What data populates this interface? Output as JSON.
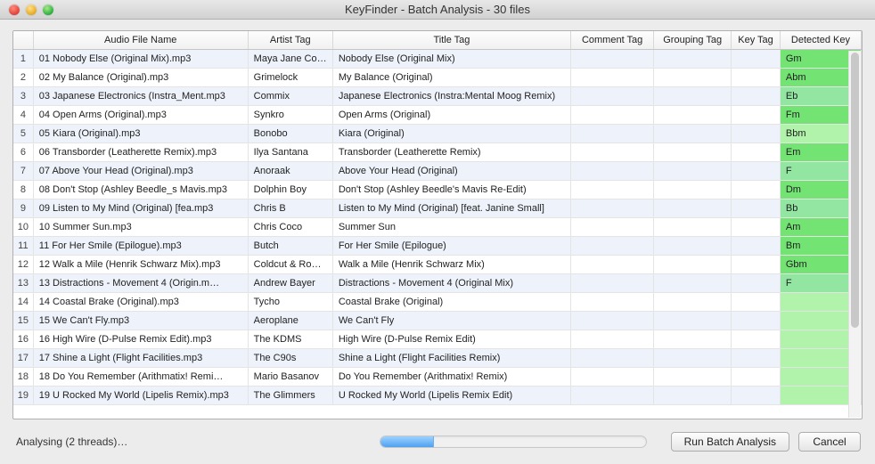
{
  "window": {
    "title": "KeyFinder - Batch Analysis - 30 files"
  },
  "columns": {
    "idx": "",
    "file": "Audio File Name",
    "artist": "Artist Tag",
    "title": "Title Tag",
    "comment": "Comment Tag",
    "grouping": "Grouping Tag",
    "keytag": "Key Tag",
    "detected": "Detected Key"
  },
  "rows": [
    {
      "n": "1",
      "file": "01 Nobody Else (Original Mix).mp3",
      "artist": "Maya Jane Coles",
      "title": "Nobody Else (Original Mix)",
      "comment": "",
      "grouping": "",
      "keytag": "",
      "detected": "Gm",
      "kclass": "k1"
    },
    {
      "n": "2",
      "file": "02 My Balance (Original).mp3",
      "artist": "Grimelock",
      "title": "My Balance (Original)",
      "comment": "",
      "grouping": "",
      "keytag": "",
      "detected": "Abm",
      "kclass": "k1"
    },
    {
      "n": "3",
      "file": "03 Japanese Electronics (Instra_Ment.mp3",
      "artist": "Commix",
      "title": "Japanese Electronics (Instra:Mental Moog Remix)",
      "comment": "",
      "grouping": "",
      "keytag": "",
      "detected": "Eb",
      "kclass": "k3"
    },
    {
      "n": "4",
      "file": "04 Open Arms (Original).mp3",
      "artist": "Synkro",
      "title": "Open Arms (Original)",
      "comment": "",
      "grouping": "",
      "keytag": "",
      "detected": "Fm",
      "kclass": "k1"
    },
    {
      "n": "5",
      "file": "05 Kiara (Original).mp3",
      "artist": "Bonobo",
      "title": "Kiara (Original)",
      "comment": "",
      "grouping": "",
      "keytag": "",
      "detected": "Bbm",
      "kclass": "k0"
    },
    {
      "n": "6",
      "file": "06 Transborder (Leatherette Remix).mp3",
      "artist": "Ilya Santana",
      "title": "Transborder (Leatherette Remix)",
      "comment": "",
      "grouping": "",
      "keytag": "",
      "detected": "Em",
      "kclass": "k1"
    },
    {
      "n": "7",
      "file": "07 Above Your Head (Original).mp3",
      "artist": "Anoraak",
      "title": "Above Your Head (Original)",
      "comment": "",
      "grouping": "",
      "keytag": "",
      "detected": "F",
      "kclass": "k3"
    },
    {
      "n": "8",
      "file": "08 Don't Stop (Ashley Beedle_s Mavis.mp3",
      "artist": "Dolphin Boy",
      "title": "Don't Stop (Ashley Beedle's Mavis Re-Edit)",
      "comment": "",
      "grouping": "",
      "keytag": "",
      "detected": "Dm",
      "kclass": "k1"
    },
    {
      "n": "9",
      "file": "09 Listen to My Mind (Original) [fea.mp3",
      "artist": "Chris B",
      "title": "Listen to My Mind (Original) [feat. Janine Small]",
      "comment": "",
      "grouping": "",
      "keytag": "",
      "detected": "Bb",
      "kclass": "k3"
    },
    {
      "n": "10",
      "file": "10 Summer Sun.mp3",
      "artist": "Chris Coco",
      "title": "Summer Sun",
      "comment": "",
      "grouping": "",
      "keytag": "",
      "detected": "Am",
      "kclass": "k1"
    },
    {
      "n": "11",
      "file": "11 For Her Smile (Epilogue).mp3",
      "artist": "Butch",
      "title": "For Her Smile (Epilogue)",
      "comment": "",
      "grouping": "",
      "keytag": "",
      "detected": "Bm",
      "kclass": "k1"
    },
    {
      "n": "12",
      "file": "12 Walk a Mile (Henrik Schwarz Mix).mp3",
      "artist": "Coldcut & Ro…",
      "title": "Walk a Mile (Henrik Schwarz Mix)",
      "comment": "",
      "grouping": "",
      "keytag": "",
      "detected": "Gbm",
      "kclass": "k1"
    },
    {
      "n": "13",
      "file": "13 Distractions - Movement 4 (Origin.m…",
      "artist": "Andrew Bayer",
      "title": "Distractions - Movement 4 (Original Mix)",
      "comment": "",
      "grouping": "",
      "keytag": "",
      "detected": "F",
      "kclass": "k3"
    },
    {
      "n": "14",
      "file": "14 Coastal Brake (Original).mp3",
      "artist": "Tycho",
      "title": "Coastal Brake (Original)",
      "comment": "",
      "grouping": "",
      "keytag": "",
      "detected": "",
      "kclass": "k0"
    },
    {
      "n": "15",
      "file": "15 We Can't Fly.mp3",
      "artist": "Aeroplane",
      "title": "We Can't Fly",
      "comment": "",
      "grouping": "",
      "keytag": "",
      "detected": "",
      "kclass": "k0"
    },
    {
      "n": "16",
      "file": "16 High Wire (D-Pulse Remix Edit).mp3",
      "artist": "The KDMS",
      "title": "High Wire (D-Pulse Remix Edit)",
      "comment": "",
      "grouping": "",
      "keytag": "",
      "detected": "",
      "kclass": "k0"
    },
    {
      "n": "17",
      "file": "17 Shine a Light (Flight Facilities.mp3",
      "artist": "The C90s",
      "title": "Shine a Light (Flight Facilities Remix)",
      "comment": "",
      "grouping": "",
      "keytag": "",
      "detected": "",
      "kclass": "k0"
    },
    {
      "n": "18",
      "file": "18 Do You Remember (Arithmatix! Remi…",
      "artist": "Mario Basanov",
      "title": "Do You Remember (Arithmatix! Remix)",
      "comment": "",
      "grouping": "",
      "keytag": "",
      "detected": "",
      "kclass": "k0"
    },
    {
      "n": "19",
      "file": "19 U Rocked My World (Lipelis Remix).mp3",
      "artist": "The Glimmers",
      "title": "U Rocked My World (Lipelis Remix Edit)",
      "comment": "",
      "grouping": "",
      "keytag": "",
      "detected": "",
      "kclass": "k0"
    }
  ],
  "footer": {
    "status": "Analysing (2 threads)…",
    "progress_pct": 20,
    "run_label": "Run Batch Analysis",
    "cancel_label": "Cancel"
  }
}
